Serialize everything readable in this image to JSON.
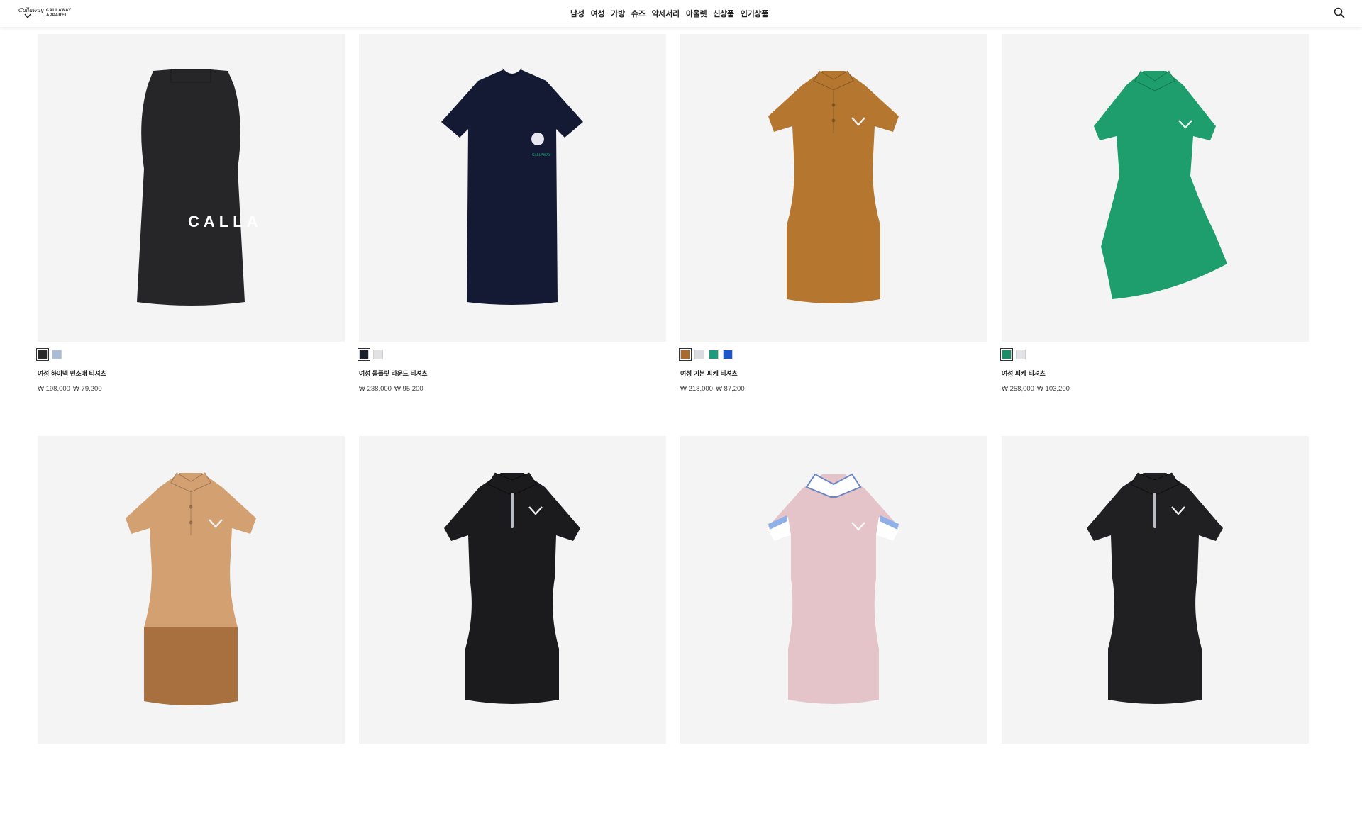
{
  "header": {
    "logo_script": "Callaway",
    "logo_line1": "CALLAWAY",
    "logo_line2": "APPAREL",
    "nav": [
      "남성",
      "여성",
      "가방",
      "슈즈",
      "악세서리",
      "아울렛",
      "신상품",
      "인기상품"
    ]
  },
  "products": [
    {
      "name": "여성 하이넥 민소매 티셔츠",
      "orig_price": "₩ 198,000",
      "sale_price": "₩ 79,200",
      "swatches": [
        "#2a2a2a",
        "#a9bcd6"
      ],
      "shirt_color": "#262628",
      "type": "sleeveless",
      "print_text": "CALLA"
    },
    {
      "name": "여성 돌플릿 라운드 티셔츠",
      "orig_price": "₩ 238,000",
      "sale_price": "₩ 95,200",
      "swatches": [
        "#1b1e2b",
        "#e2e2e5"
      ],
      "shirt_color": "#141a33",
      "type": "crew"
    },
    {
      "name": "여성 기본 피케 티셔츠",
      "orig_price": "₩ 218,000",
      "sale_price": "₩ 87,200",
      "swatches": [
        "#a86a2e",
        "#d9dbe0",
        "#1e9a7c",
        "#1d56c9"
      ],
      "shirt_color": "#b5772f",
      "type": "polo"
    },
    {
      "name": "여성 피케 티셔츠",
      "orig_price": "₩ 258,000",
      "sale_price": "₩ 103,200",
      "swatches": [
        "#1a8f67",
        "#e2e3e6"
      ],
      "shirt_color": "#1e9e6c",
      "type": "peplum"
    },
    {
      "name": "",
      "orig_price": "",
      "sale_price": "",
      "swatches": [],
      "shirt_color": "#d3a072",
      "type": "colorblock",
      "bottom_color": "#a8703e"
    },
    {
      "name": "",
      "orig_price": "",
      "sale_price": "",
      "swatches": [],
      "shirt_color": "#1b1b1d",
      "type": "zip"
    },
    {
      "name": "",
      "orig_price": "",
      "sale_price": "",
      "swatches": [],
      "shirt_color": "#e5c4c9",
      "type": "stripe"
    },
    {
      "name": "",
      "orig_price": "",
      "sale_price": "",
      "swatches": [],
      "shirt_color": "#202022",
      "type": "zip"
    }
  ]
}
